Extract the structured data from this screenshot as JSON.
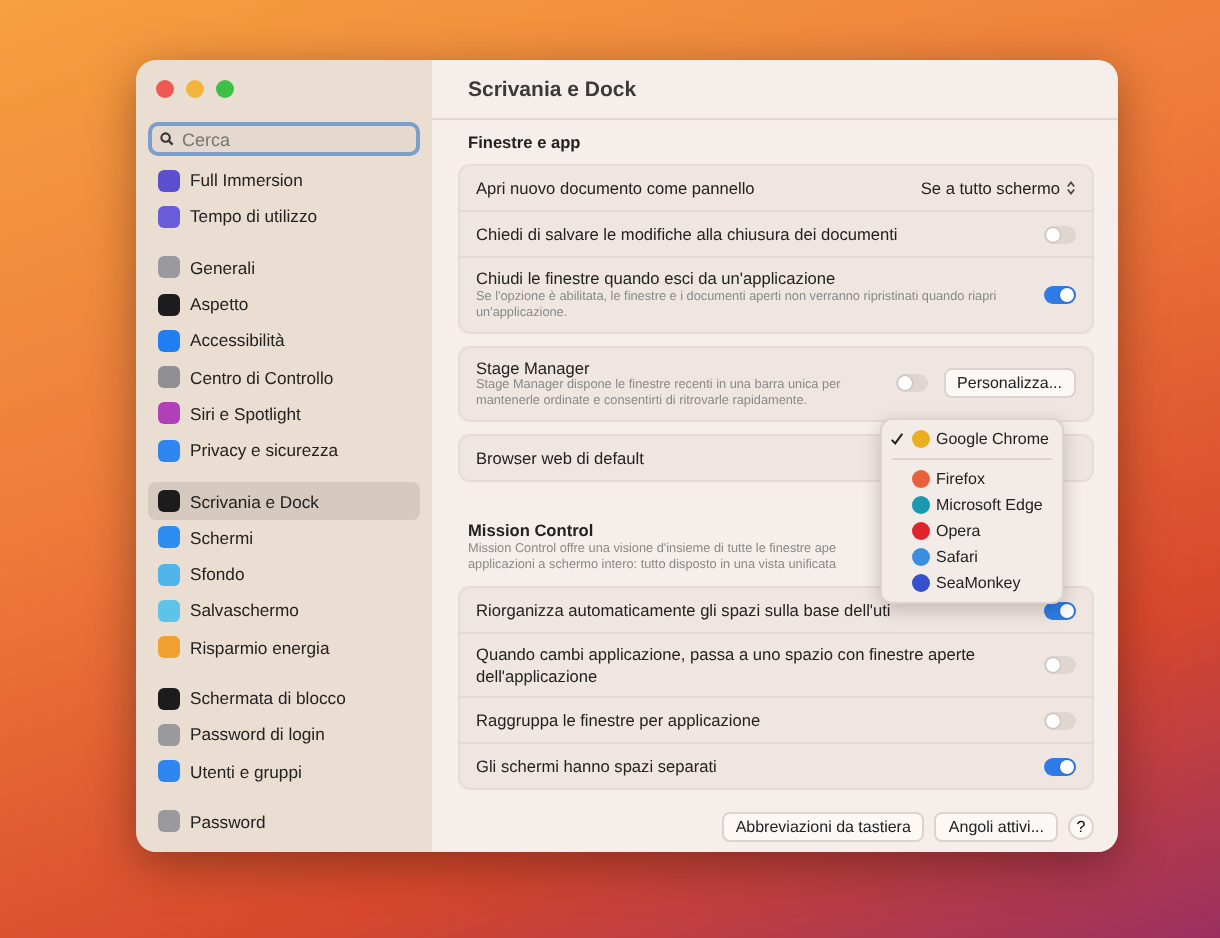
{
  "window": {
    "title": "Scrivania e Dock"
  },
  "sidebar": {
    "search": {
      "placeholder": "Cerca"
    },
    "groups": [
      {
        "items": [
          {
            "label": "Full Immersion",
            "color": "#5b4fd0",
            "selected": false
          },
          {
            "label": "Tempo di utilizzo",
            "color": "#6a5bd8",
            "selected": false
          }
        ]
      },
      {
        "items": [
          {
            "label": "Generali",
            "color": "#9a9a9e",
            "selected": false
          },
          {
            "label": "Aspetto",
            "color": "#1c1c1e",
            "selected": false
          },
          {
            "label": "Accessibilità",
            "color": "#1f7ff0",
            "selected": false
          },
          {
            "label": "Centro di Controllo",
            "color": "#8e8e93",
            "selected": false
          },
          {
            "label": "Siri e Spotlight",
            "color": "#b03fb8",
            "selected": false
          },
          {
            "label": "Privacy e sicurezza",
            "color": "#2f86f0",
            "selected": false
          }
        ]
      },
      {
        "items": [
          {
            "label": "Scrivania e Dock",
            "color": "#1c1c1e",
            "selected": true
          },
          {
            "label": "Schermi",
            "color": "#2d8cf0",
            "selected": false
          },
          {
            "label": "Sfondo",
            "color": "#4fb4ea",
            "selected": false
          },
          {
            "label": "Salvaschermo",
            "color": "#5ec3e8",
            "selected": false
          },
          {
            "label": "Risparmio energia",
            "color": "#f0a030",
            "selected": false
          }
        ]
      },
      {
        "items": [
          {
            "label": "Schermata di blocco",
            "color": "#1c1c1e",
            "selected": false
          },
          {
            "label": "Password di login",
            "color": "#9a9a9e",
            "selected": false
          },
          {
            "label": "Utenti e gruppi",
            "color": "#2f86f0",
            "selected": false
          }
        ]
      },
      {
        "items": [
          {
            "label": "Password",
            "color": "#9a9a9e",
            "selected": false
          }
        ]
      }
    ]
  },
  "sections": [
    {
      "heading": "Finestre e app",
      "rows": [
        {
          "kind": "select",
          "label": "Apri nuovo documento come pannello",
          "value": "Se a tutto schermo"
        },
        {
          "kind": "toggle",
          "label": "Chiedi di salvare le modifiche alla chiusura dei documenti",
          "on": false
        },
        {
          "kind": "toggle",
          "label": "Chiudi le finestre quando esci da un'applicazione",
          "description": "Se l'opzione è abilitata, le finestre e i documenti aperti non verranno ripristinati quando riapri un'applicazione.",
          "on": true
        }
      ]
    },
    {
      "rows": [
        {
          "kind": "toggle",
          "label": "Stage Manager",
          "description": "Stage Manager dispone le finestre recenti in una barra unica per mantenerle ordinate e consentirti di ritrovarle rapidamente.",
          "on": false,
          "button": "Personalizza..."
        }
      ]
    },
    {
      "rows": [
        {
          "kind": "menu",
          "label": "Browser web di default"
        }
      ]
    },
    {
      "heading": "Mission Control",
      "description": [
        "Mission Control offre una visione d'insieme di tutte le finestre ape",
        "applicazioni a schermo intero: tutto disposto in una vista unificata"
      ],
      "rows": [
        {
          "kind": "toggle",
          "label": "Riorganizza automaticamente gli spazi sulla base dell'uti",
          "on": true
        },
        {
          "kind": "toggle",
          "label": "Quando cambi applicazione, passa a uno spazio con finestre aperte dell'applicazione",
          "on": false
        },
        {
          "kind": "toggle",
          "label": "Raggruppa le finestre per applicazione",
          "on": false
        },
        {
          "kind": "toggle",
          "label": "Gli schermi hanno spazi separati",
          "on": true
        }
      ]
    }
  ],
  "footer_buttons": [
    "Abbreviazioni da tastiera",
    "Angoli attivi..."
  ],
  "help_button": "?",
  "browser_menu": [
    {
      "label": "Google Chrome",
      "selected": true,
      "color": "#e8b020"
    },
    {
      "label": "Firefox",
      "selected": false,
      "color": "#e8603c"
    },
    {
      "label": "Microsoft Edge",
      "selected": false,
      "color": "#1a9ab0"
    },
    {
      "label": "Opera",
      "selected": false,
      "color": "#e0242c"
    },
    {
      "label": "Safari",
      "selected": false,
      "color": "#3a8ee0"
    },
    {
      "label": "SeaMonkey",
      "selected": false,
      "color": "#3550c8"
    }
  ]
}
